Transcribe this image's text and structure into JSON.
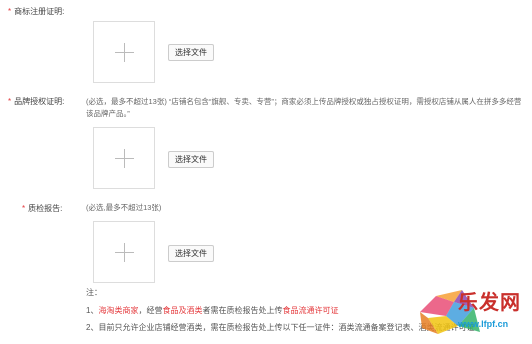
{
  "fields": [
    {
      "label": "商标注册证明:",
      "button_label": "选择文件"
    },
    {
      "label": "品牌授权证明:",
      "hint": "(必选，最多不超过13张) “店铺名包含“旗舰、专卖、专营”；商家必须上传品牌授权或独占授权证明，需授权店铺从属人在拼多多经营该品牌产品。”",
      "button_label": "选择文件"
    },
    {
      "label": "质检报告:",
      "hint": "(必选,最多不超过13张)",
      "button_label": "选择文件"
    }
  ],
  "notes": {
    "title": "注：",
    "line1_prefix": "1、",
    "line1_red_a": "海淘类商家",
    "line1_mid": "，经营",
    "line1_red_b": "食品及酒类",
    "line1_after": "者需在质检报告处上传",
    "line1_red_c": "食品流通许可证",
    "line2": "2、目前只允许企业店铺经营酒类，需在质检报告处上传以下任一证件：酒类流通备案登记表、酒类流通许可证"
  },
  "watermark": {
    "text": "乐发网",
    "url": "www.lfpf.cn"
  },
  "colors": {
    "required": "#e4393c",
    "accent": "#1b9bd8"
  }
}
